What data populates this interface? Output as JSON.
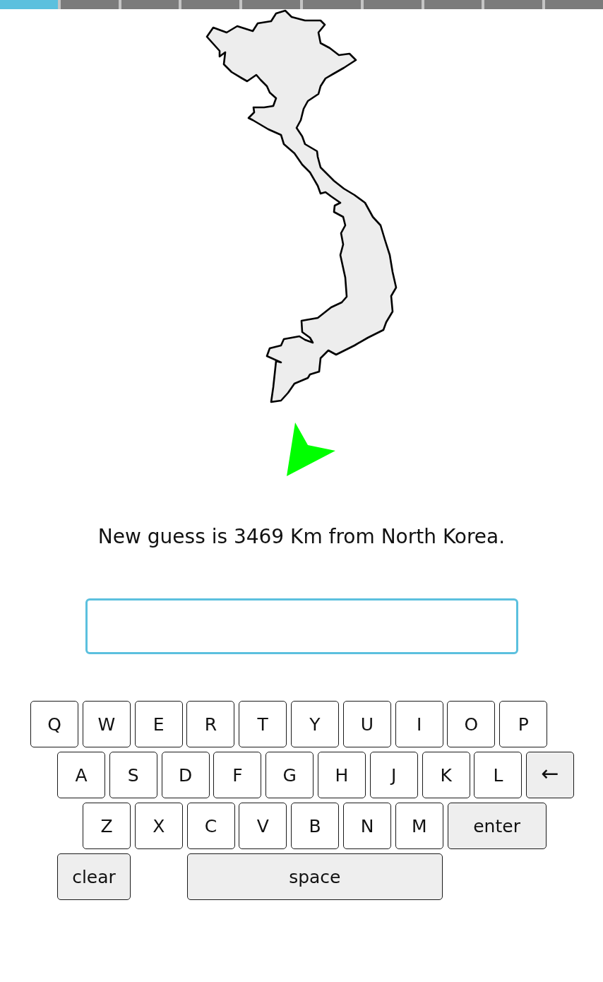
{
  "progress": [
    {
      "current": true
    },
    {
      "current": false
    },
    {
      "current": false
    },
    {
      "current": false
    },
    {
      "current": false
    },
    {
      "current": false
    },
    {
      "current": false
    },
    {
      "current": false
    },
    {
      "current": false
    },
    {
      "current": false
    }
  ],
  "message": "New guess is 3469 Km from North Korea.",
  "guess_field": {
    "focused": true
  },
  "keyboard": {
    "key_rows": [
      {
        "keys": [
          {
            "label": "Q",
            "kind": "letter"
          },
          {
            "label": "W",
            "kind": "letter"
          },
          {
            "label": "E",
            "kind": "letter"
          },
          {
            "label": "R",
            "kind": "letter"
          },
          {
            "label": "T",
            "kind": "letter"
          },
          {
            "label": "Y",
            "kind": "letter"
          },
          {
            "label": "U",
            "kind": "letter"
          },
          {
            "label": "I",
            "kind": "letter"
          },
          {
            "label": "O",
            "kind": "letter"
          },
          {
            "label": "P",
            "kind": "letter"
          }
        ]
      },
      {
        "keys": [
          {
            "label": "A",
            "kind": "letter"
          },
          {
            "label": "S",
            "kind": "letter"
          },
          {
            "label": "D",
            "kind": "letter"
          },
          {
            "label": "F",
            "kind": "letter"
          },
          {
            "label": "G",
            "kind": "letter"
          },
          {
            "label": "H",
            "kind": "letter"
          },
          {
            "label": "J",
            "kind": "letter"
          },
          {
            "label": "K",
            "kind": "letter"
          },
          {
            "label": "L",
            "kind": "letter"
          },
          {
            "label": "←",
            "kind": "backspace"
          }
        ]
      },
      {
        "keys": [
          {
            "label": "Z",
            "kind": "letter"
          },
          {
            "label": "X",
            "kind": "letter"
          },
          {
            "label": "C",
            "kind": "letter"
          },
          {
            "label": "V",
            "kind": "letter"
          },
          {
            "label": "B",
            "kind": "letter"
          },
          {
            "label": "N",
            "kind": "letter"
          },
          {
            "label": "M",
            "kind": "letter"
          },
          {
            "label": "enter",
            "kind": "enter"
          }
        ]
      },
      {
        "keys": [
          {
            "label": "clear",
            "kind": "clear"
          },
          {
            "label": "space",
            "kind": "space"
          }
        ]
      }
    ]
  }
}
